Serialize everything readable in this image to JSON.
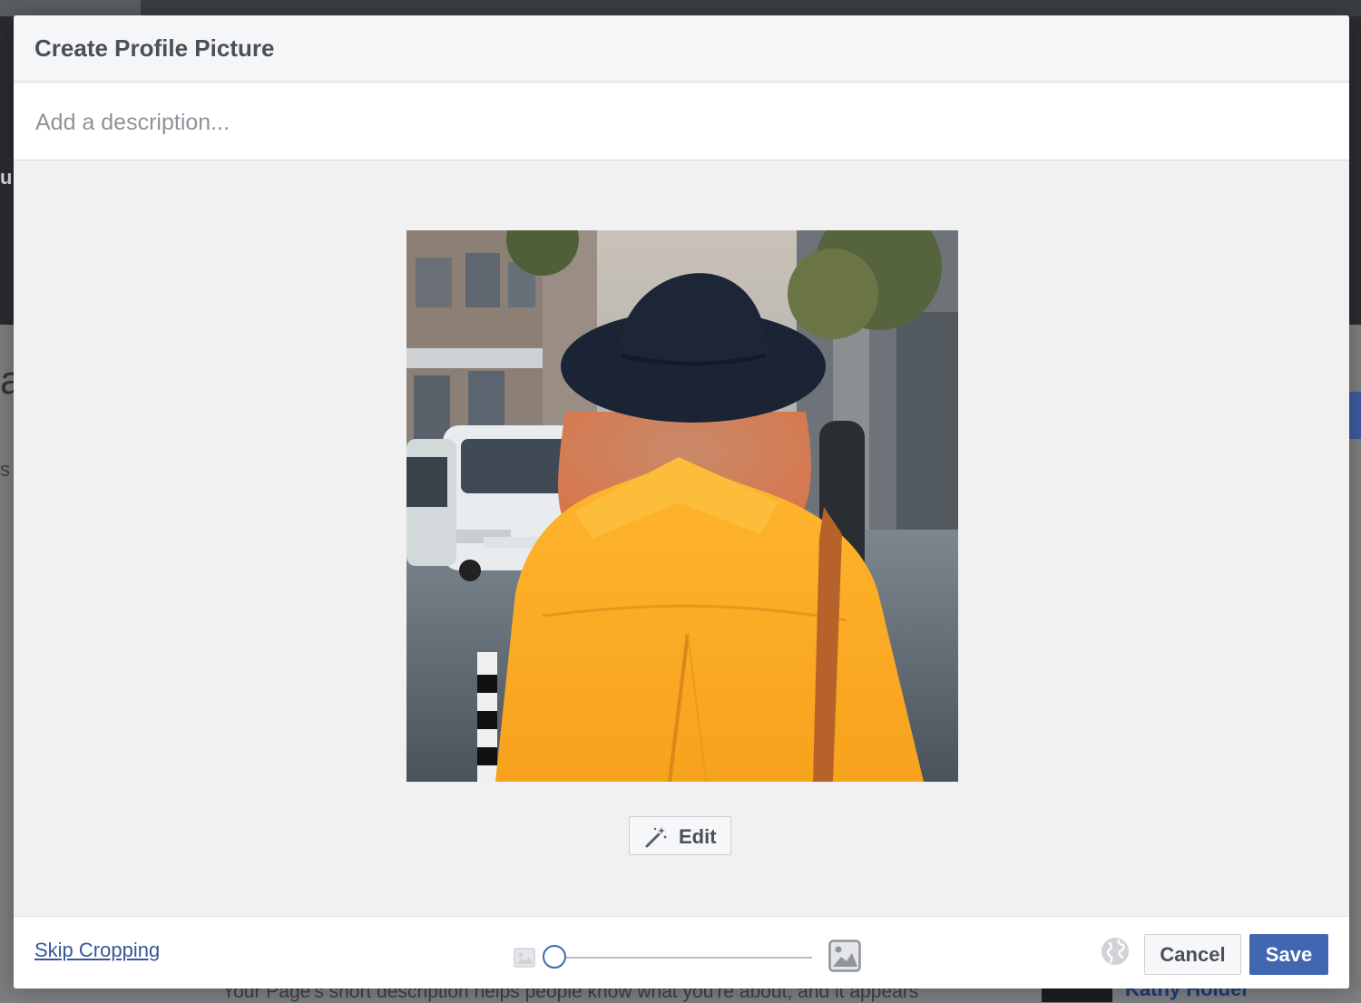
{
  "dialog": {
    "title": "Create Profile Picture",
    "description_placeholder": "Add a description...",
    "description_value": "",
    "edit_label": "Edit",
    "skip_cropping_label": "Skip Cropping",
    "cancel_label": "Cancel",
    "save_label": "Save",
    "zoom_level": 0,
    "colors": {
      "save_button": "#4267b2",
      "link": "#365899",
      "title": "#4b4f56"
    },
    "icons": {
      "edit": "magic-wand-icon",
      "zoom_out": "small-image-icon",
      "zoom_in": "large-image-icon",
      "privacy": "globe-icon"
    }
  },
  "background_page": {
    "description_snippet": "Your Page's short description helps people know what you're about, and it appears",
    "name_snippet": "Kathy Holder"
  }
}
